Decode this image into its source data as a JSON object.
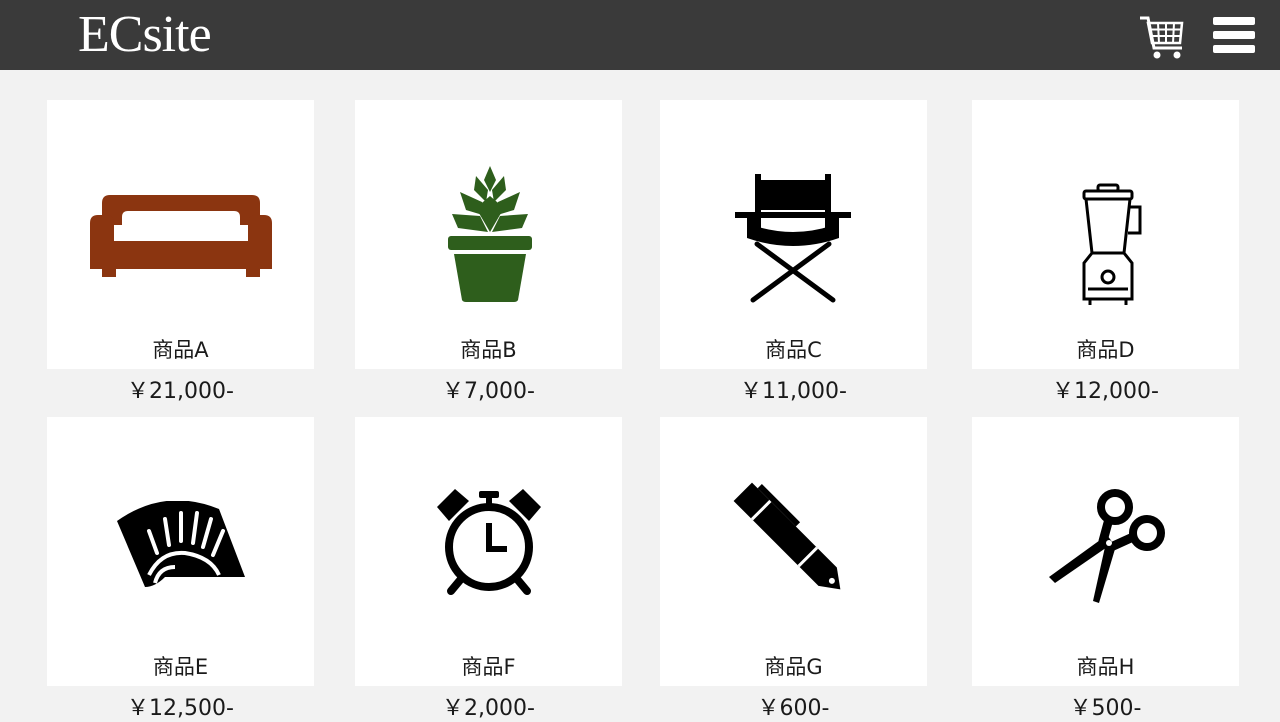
{
  "header": {
    "logo": "ECsite",
    "cart_icon": "cart-icon",
    "menu_icon": "hamburger-menu-icon"
  },
  "products": [
    {
      "name": "商品A",
      "price": "￥21,000-",
      "icon": "sofa-icon",
      "icon_color": "#8b3510"
    },
    {
      "name": "商品B",
      "price": "￥7,000-",
      "icon": "potted-plant-icon",
      "icon_color": "#2e5e1c"
    },
    {
      "name": "商品C",
      "price": "￥11,000-",
      "icon": "directors-chair-icon",
      "icon_color": "#000000"
    },
    {
      "name": "商品D",
      "price": "￥12,000-",
      "icon": "blender-icon",
      "icon_color": "#000000"
    },
    {
      "name": "商品E",
      "price": "￥12,500-",
      "icon": "folding-fan-icon",
      "icon_color": "#000000"
    },
    {
      "name": "商品F",
      "price": "￥2,000-",
      "icon": "alarm-clock-icon",
      "icon_color": "#000000"
    },
    {
      "name": "商品G",
      "price": "￥600-",
      "icon": "pen-icon",
      "icon_color": "#000000"
    },
    {
      "name": "商品H",
      "price": "￥500-",
      "icon": "scissors-icon",
      "icon_color": "#000000"
    }
  ]
}
